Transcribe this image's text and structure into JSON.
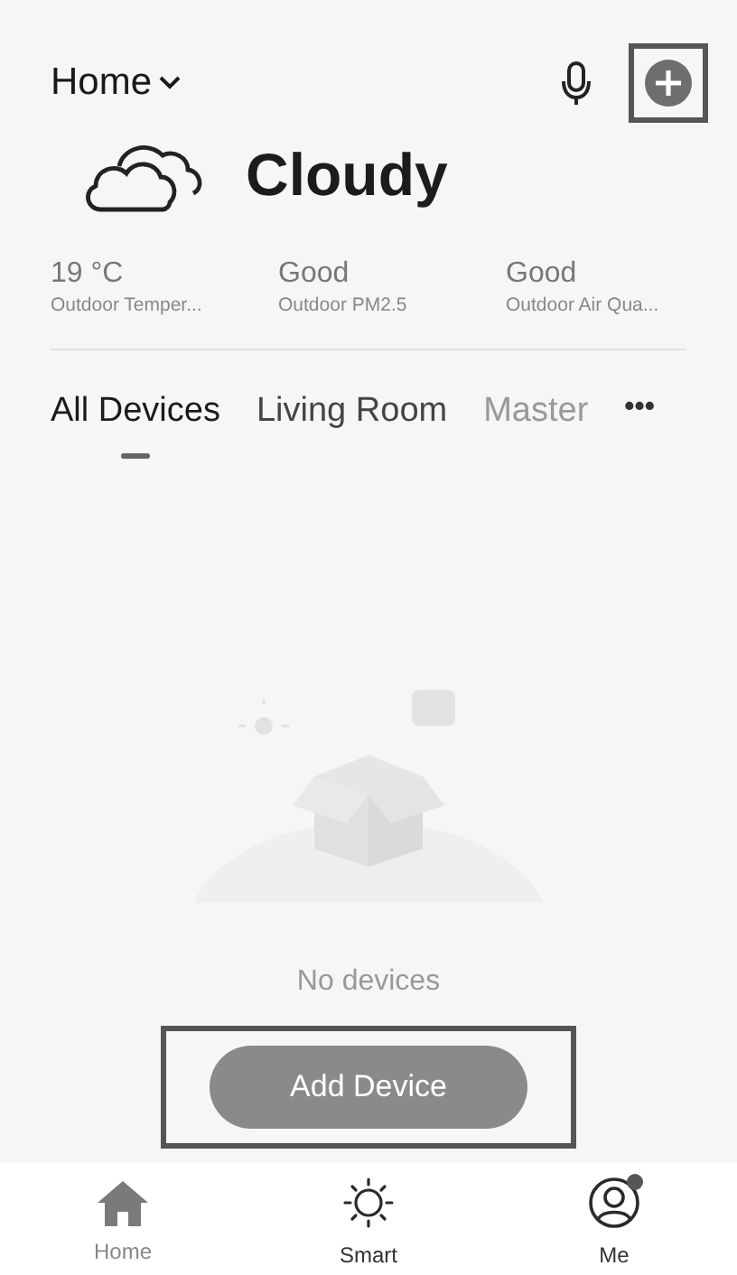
{
  "header": {
    "home_label": "Home",
    "add_highlighted": true
  },
  "weather": {
    "condition": "Cloudy"
  },
  "stats": [
    {
      "value": "19 °C",
      "label": "Outdoor Temper..."
    },
    {
      "value": "Good",
      "label": "Outdoor PM2.5"
    },
    {
      "value": "Good",
      "label": "Outdoor Air Qua..."
    }
  ],
  "tabs": [
    {
      "label": "All Devices",
      "selected": true
    },
    {
      "label": "Living Room",
      "selected": false
    },
    {
      "label": "Master",
      "selected": false
    }
  ],
  "more": "•••",
  "empty": {
    "message": "No devices",
    "button": "Add Device",
    "button_highlighted": true
  },
  "nav": [
    {
      "kind": "home",
      "label": "Home",
      "selected": true,
      "badge": false
    },
    {
      "kind": "smart",
      "label": "Smart",
      "selected": false,
      "badge": false
    },
    {
      "kind": "me",
      "label": "Me",
      "selected": false,
      "badge": true
    }
  ]
}
